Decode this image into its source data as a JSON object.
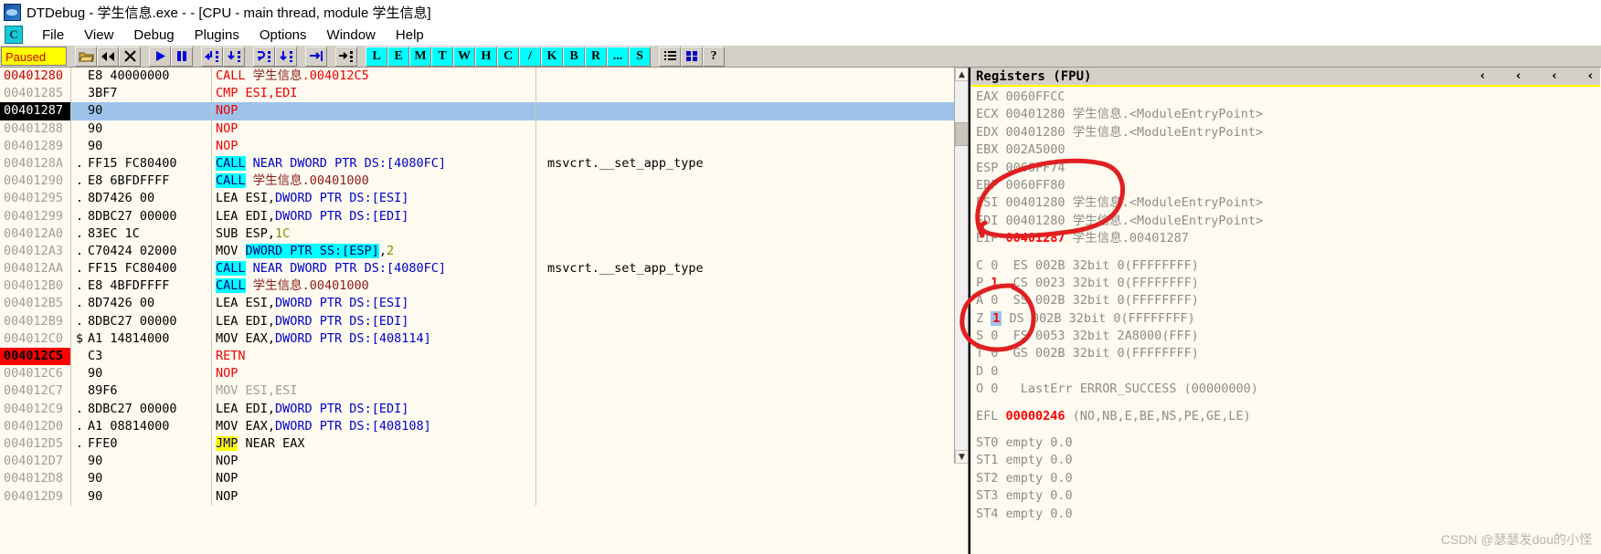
{
  "window": {
    "title": "DTDebug - 学生信息.exe - - [CPU - main thread, module 学生信息]",
    "icon": "app-icon"
  },
  "menu": {
    "sysicon": "C",
    "items": [
      "File",
      "View",
      "Debug",
      "Plugins",
      "Options",
      "Window",
      "Help"
    ]
  },
  "toolbar": {
    "status": "Paused",
    "icons": [
      "open-folder-icon",
      "restart-icon",
      "close-icon",
      "run-icon",
      "pause-icon",
      "step-into-icon",
      "step-over-icon",
      "trace-into-icon",
      "trace-over-icon",
      "execute-till-return-icon",
      "execute-till-cursor-icon"
    ],
    "letters": [
      "L",
      "E",
      "M",
      "T",
      "W",
      "H",
      "C",
      "/",
      "K",
      "B",
      "R",
      "...",
      "S"
    ],
    "extra_icons": [
      "options-list-icon",
      "windows-tile-icon",
      "help-icon"
    ]
  },
  "disassembly": {
    "rows": [
      {
        "address": "00401280",
        "mark": "",
        "bytes": "E8 40000000",
        "parts": [
          {
            "t": "CALL ",
            "c": "red"
          },
          {
            "t": "学生信息",
            "c": "cjk"
          },
          {
            "t": ".004012C5",
            "c": "red"
          }
        ],
        "comment": "",
        "style": "first"
      },
      {
        "address": "00401285",
        "mark": "",
        "bytes": "3BF7",
        "parts": [
          {
            "t": "CMP ESI,EDI",
            "c": "red"
          }
        ],
        "comment": "",
        "style": ""
      },
      {
        "address": "00401287",
        "mark": "",
        "bytes": "90",
        "parts": [
          {
            "t": "NOP",
            "c": "red"
          }
        ],
        "comment": "",
        "style": "sel"
      },
      {
        "address": "00401288",
        "mark": "",
        "bytes": "90",
        "parts": [
          {
            "t": "NOP",
            "c": "red"
          }
        ],
        "comment": "",
        "style": ""
      },
      {
        "address": "00401289",
        "mark": "",
        "bytes": "90",
        "parts": [
          {
            "t": "NOP",
            "c": "red"
          }
        ],
        "comment": "",
        "style": ""
      },
      {
        "address": "0040128A",
        "mark": ".",
        "bytes": "FF15 FC80400",
        "parts": [
          {
            "t": "CALL",
            "c": "cyanbg"
          },
          {
            "t": " NEAR ",
            "c": "blue"
          },
          {
            "t": "DWORD PTR DS:[4080FC]",
            "c": "blue"
          }
        ],
        "comment": "msvcrt.__set_app_type",
        "style": ""
      },
      {
        "address": "00401290",
        "mark": ".",
        "bytes": "E8 6BFDFFFF",
        "parts": [
          {
            "t": "CALL",
            "c": "cyanbg"
          },
          {
            "t": " ",
            "c": "black"
          },
          {
            "t": "学生信息",
            "c": "cjk"
          },
          {
            "t": ".00401000",
            "c": "dred"
          }
        ],
        "comment": "",
        "style": ""
      },
      {
        "address": "00401295",
        "mark": ".",
        "bytes": "8D7426 00",
        "parts": [
          {
            "t": "LEA ESI,",
            "c": "black"
          },
          {
            "t": "DWORD PTR DS:[ESI]",
            "c": "blue"
          }
        ],
        "comment": "",
        "style": ""
      },
      {
        "address": "00401299",
        "mark": ".",
        "bytes": "8DBC27 00000",
        "parts": [
          {
            "t": "LEA EDI,",
            "c": "black"
          },
          {
            "t": "DWORD PTR DS:[EDI]",
            "c": "blue"
          }
        ],
        "comment": "",
        "style": ""
      },
      {
        "address": "004012A0",
        "mark": ".",
        "bytes": "83EC 1C",
        "parts": [
          {
            "t": "SUB ESP,",
            "c": "black"
          },
          {
            "t": "1C",
            "c": "olive"
          }
        ],
        "comment": "",
        "style": ""
      },
      {
        "address": "004012A3",
        "mark": ".",
        "bytes": "C70424 02000",
        "parts": [
          {
            "t": "MOV ",
            "c": "black"
          },
          {
            "t": "DWORD PTR SS:[ESP]",
            "c": "cyanbg2"
          },
          {
            "t": ",",
            "c": "black"
          },
          {
            "t": "2",
            "c": "olive"
          }
        ],
        "comment": "",
        "style": ""
      },
      {
        "address": "004012AA",
        "mark": ".",
        "bytes": "FF15 FC80400",
        "parts": [
          {
            "t": "CALL",
            "c": "cyanbg"
          },
          {
            "t": " NEAR ",
            "c": "blue"
          },
          {
            "t": "DWORD PTR DS:[4080FC]",
            "c": "blue"
          }
        ],
        "comment": "msvcrt.__set_app_type",
        "style": ""
      },
      {
        "address": "004012B0",
        "mark": ".",
        "bytes": "E8 4BFDFFFF",
        "parts": [
          {
            "t": "CALL",
            "c": "cyanbg"
          },
          {
            "t": " ",
            "c": "black"
          },
          {
            "t": "学生信息",
            "c": "cjk"
          },
          {
            "t": ".00401000",
            "c": "dred"
          }
        ],
        "comment": "",
        "style": ""
      },
      {
        "address": "004012B5",
        "mark": ".",
        "bytes": "8D7426 00",
        "parts": [
          {
            "t": "LEA ESI,",
            "c": "black"
          },
          {
            "t": "DWORD PTR DS:[ESI]",
            "c": "blue"
          }
        ],
        "comment": "",
        "style": ""
      },
      {
        "address": "004012B9",
        "mark": ".",
        "bytes": "8DBC27 00000",
        "parts": [
          {
            "t": "LEA EDI,",
            "c": "black"
          },
          {
            "t": "DWORD PTR DS:[EDI]",
            "c": "blue"
          }
        ],
        "comment": "",
        "style": ""
      },
      {
        "address": "004012C0",
        "mark": "$",
        "bytes": "A1 14814000",
        "parts": [
          {
            "t": "MOV EAX,",
            "c": "black"
          },
          {
            "t": "DWORD PTR DS:[408114]",
            "c": "blue"
          }
        ],
        "comment": "",
        "style": ""
      },
      {
        "address": "004012C5",
        "mark": "",
        "bytes": "C3",
        "parts": [
          {
            "t": "RETN",
            "c": "red"
          }
        ],
        "comment": "",
        "style": "eip-red"
      },
      {
        "address": "004012C6",
        "mark": "",
        "bytes": "90",
        "parts": [
          {
            "t": "NOP",
            "c": "red"
          }
        ],
        "comment": "",
        "style": ""
      },
      {
        "address": "004012C7",
        "mark": "",
        "bytes": "89F6",
        "parts": [
          {
            "t": "MOV ESI,ESI",
            "c": "gray"
          }
        ],
        "comment": "",
        "style": ""
      },
      {
        "address": "004012C9",
        "mark": ".",
        "bytes": "8DBC27 00000",
        "parts": [
          {
            "t": "LEA EDI,",
            "c": "black"
          },
          {
            "t": "DWORD PTR DS:[EDI]",
            "c": "blue"
          }
        ],
        "comment": "",
        "style": ""
      },
      {
        "address": "004012D0",
        "mark": ".",
        "bytes": "A1 08814000",
        "parts": [
          {
            "t": "MOV EAX,",
            "c": "black"
          },
          {
            "t": "DWORD PTR DS:[408108]",
            "c": "blue"
          }
        ],
        "comment": "",
        "style": ""
      },
      {
        "address": "004012D5",
        "mark": ".",
        "bytes": "FFE0",
        "parts": [
          {
            "t": "JMP",
            "c": "yellowbg"
          },
          {
            "t": " NEAR EAX",
            "c": "black"
          }
        ],
        "comment": "",
        "style": ""
      },
      {
        "address": "004012D7",
        "mark": "",
        "bytes": "90",
        "parts": [
          {
            "t": "NOP",
            "c": "black"
          }
        ],
        "comment": "",
        "style": ""
      },
      {
        "address": "004012D8",
        "mark": "",
        "bytes": "90",
        "parts": [
          {
            "t": "NOP",
            "c": "black"
          }
        ],
        "comment": "",
        "style": ""
      },
      {
        "address": "004012D9",
        "mark": "",
        "bytes": "90",
        "parts": [
          {
            "t": "NOP",
            "c": "black"
          }
        ],
        "comment": "",
        "style": ""
      }
    ]
  },
  "registers": {
    "title": "Registers (FPU)",
    "chevrons": [
      "‹",
      "‹",
      "‹",
      "‹"
    ],
    "general": [
      {
        "name": "EAX",
        "value": "0060FFCC",
        "cjk": "",
        "note": ""
      },
      {
        "name": "ECX",
        "value": "00401280",
        "cjk": "学生信息",
        "note": ".<ModuleEntryPoint>"
      },
      {
        "name": "EDX",
        "value": "00401280",
        "cjk": "学生信息",
        "note": ".<ModuleEntryPoint>"
      },
      {
        "name": "EBX",
        "value": "002A5000",
        "cjk": "",
        "note": ""
      },
      {
        "name": "ESP",
        "value": "0060FF74",
        "cjk": "",
        "note": ""
      },
      {
        "name": "EBP",
        "value": "0060FF80",
        "cjk": "",
        "note": ""
      },
      {
        "name": "ESI",
        "value": "00401280",
        "cjk": "学生信息",
        "note": ".<ModuleEntryPoint>"
      },
      {
        "name": "EDI",
        "value": "00401280",
        "cjk": "学生信息",
        "note": ".<ModuleEntryPoint>"
      }
    ],
    "eip": {
      "name": "EIP",
      "value": "00401287",
      "cjk": "学生信息",
      "note": ".00401287"
    },
    "flags": [
      {
        "flag": "C",
        "bit": "0",
        "seg": "ES",
        "sel": "002B",
        "mode": "32bit",
        "base": "0(FFFFFFFF)",
        "highlight": false
      },
      {
        "flag": "P",
        "bit": "1",
        "seg": "CS",
        "sel": "0023",
        "mode": "32bit",
        "base": "0(FFFFFFFF)",
        "highlight": false
      },
      {
        "flag": "A",
        "bit": "0",
        "seg": "SS",
        "sel": "002B",
        "mode": "32bit",
        "base": "0(FFFFFFFF)",
        "highlight": false
      },
      {
        "flag": "Z",
        "bit": "1",
        "seg": "DS",
        "sel": "002B",
        "mode": "32bit",
        "base": "0(FFFFFFFF)",
        "highlight": true
      },
      {
        "flag": "S",
        "bit": "0",
        "seg": "FS",
        "sel": "0053",
        "mode": "32bit",
        "base": "2A8000(FFF)",
        "highlight": false
      },
      {
        "flag": "T",
        "bit": "0",
        "seg": "GS",
        "sel": "002B",
        "mode": "32bit",
        "base": "0(FFFFFFFF)",
        "highlight": false
      },
      {
        "flag": "D",
        "bit": "0",
        "seg": "",
        "sel": "",
        "mode": "",
        "base": "",
        "highlight": false
      },
      {
        "flag": "O",
        "bit": "0",
        "seg": "",
        "sel": "",
        "mode": "",
        "base": "LastErr ERROR_SUCCESS (00000000)",
        "highlight": false
      }
    ],
    "efl": {
      "name": "EFL",
      "value": "00000246",
      "decoded": "(NO,NB,E,BE,NS,PE,GE,LE)"
    },
    "fpu": [
      {
        "name": "ST0",
        "state": "empty",
        "value": "0.0"
      },
      {
        "name": "ST1",
        "state": "empty",
        "value": "0.0"
      },
      {
        "name": "ST2",
        "state": "empty",
        "value": "0.0"
      },
      {
        "name": "ST3",
        "state": "empty",
        "value": "0.0"
      },
      {
        "name": "ST4",
        "state": "empty",
        "value": "0.0"
      }
    ]
  },
  "annotations": {
    "color": "#e02020",
    "shapes": [
      "ellipse-around-ebp-esi-edi-eip",
      "ellipse-around-zero-flag"
    ]
  },
  "watermark": "CSDN @瑟瑟发dou的小怪"
}
